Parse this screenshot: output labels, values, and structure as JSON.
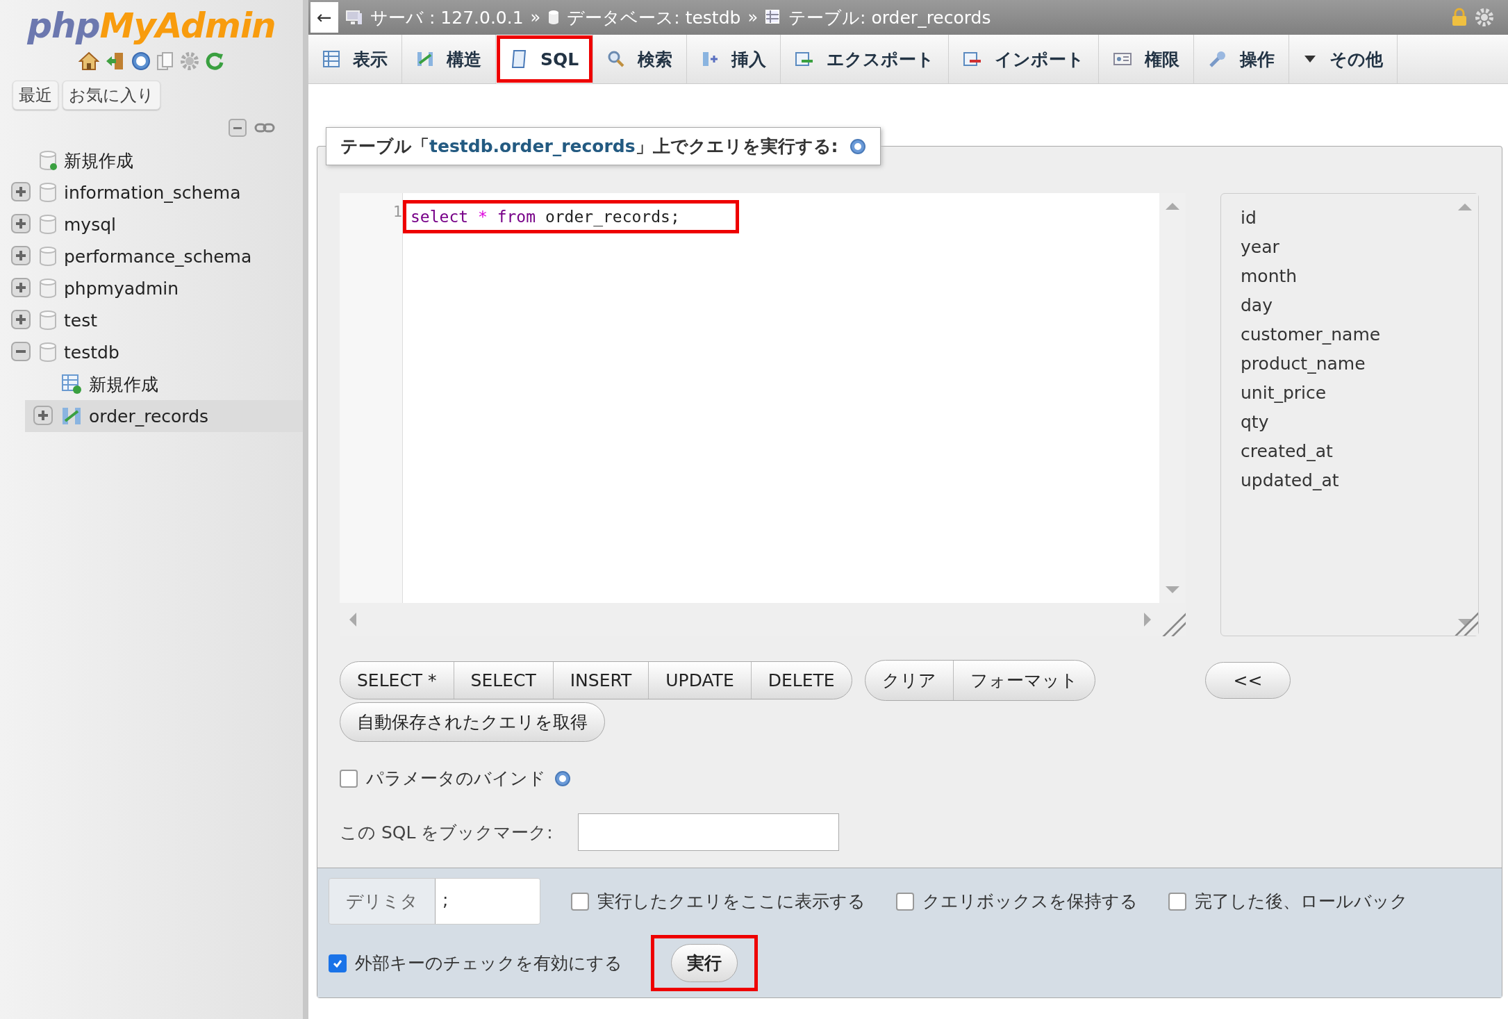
{
  "sidebar": {
    "logo": {
      "left": "php",
      "right": "MyAdmin"
    },
    "quick_tabs": [
      {
        "label": "最近"
      },
      {
        "label": "お気に入り"
      }
    ],
    "tree": [
      {
        "label": "新規作成",
        "kind": "new-db",
        "selected": false
      },
      {
        "label": "information_schema",
        "kind": "db",
        "expanded": false,
        "selected": false
      },
      {
        "label": "mysql",
        "kind": "db",
        "expanded": false,
        "selected": false
      },
      {
        "label": "performance_schema",
        "kind": "db",
        "expanded": false,
        "selected": false
      },
      {
        "label": "phpmyadmin",
        "kind": "db",
        "expanded": false,
        "selected": false
      },
      {
        "label": "test",
        "kind": "db",
        "expanded": false,
        "selected": false
      },
      {
        "label": "testdb",
        "kind": "db",
        "expanded": true,
        "selected": false,
        "children": [
          {
            "label": "新規作成",
            "kind": "new-table",
            "selected": false
          },
          {
            "label": "order_records",
            "kind": "table",
            "expanded": false,
            "selected": true
          }
        ]
      }
    ]
  },
  "breadcrumb": {
    "back": "←",
    "separator": "»",
    "items": [
      {
        "kind": "server",
        "label": "サーバ : 127.0.0.1"
      },
      {
        "kind": "database",
        "label": "データベース: testdb"
      },
      {
        "kind": "table",
        "label": "テーブル: order_records"
      }
    ]
  },
  "tabs": [
    {
      "label": "表示",
      "kind": "browse",
      "selected": false,
      "highlighted": false
    },
    {
      "label": "構造",
      "kind": "structure",
      "selected": false,
      "highlighted": false
    },
    {
      "label": "SQL",
      "kind": "sql",
      "selected": true,
      "highlighted": true
    },
    {
      "label": "検索",
      "kind": "search",
      "selected": false,
      "highlighted": false
    },
    {
      "label": "挿入",
      "kind": "insert",
      "selected": false,
      "highlighted": false
    },
    {
      "label": "エクスポート",
      "kind": "export",
      "selected": false,
      "highlighted": false
    },
    {
      "label": "インポート",
      "kind": "import",
      "selected": false,
      "highlighted": false
    },
    {
      "label": "権限",
      "kind": "privileges",
      "selected": false,
      "highlighted": false
    },
    {
      "label": "操作",
      "kind": "operations",
      "selected": false,
      "highlighted": false
    },
    {
      "label": "その他",
      "kind": "more",
      "selected": false,
      "highlighted": false
    }
  ],
  "query_panel": {
    "legend": {
      "before": "テーブル「",
      "table": "testdb.order_records",
      "after": "」上でクエリを実行する:"
    },
    "editor": {
      "line_number": "1",
      "highlighted": true,
      "tokens": [
        {
          "text": "select",
          "kind": "keyword"
        },
        {
          "text": "*",
          "kind": "operator"
        },
        {
          "text": "from",
          "kind": "keyword"
        },
        {
          "text": "order_records;",
          "kind": "plain"
        }
      ]
    },
    "columns": [
      "id",
      "year",
      "month",
      "day",
      "customer_name",
      "product_name",
      "unit_price",
      "qty",
      "created_at",
      "updated_at"
    ],
    "button_groups": [
      [
        "SELECT *",
        "SELECT",
        "INSERT",
        "UPDATE",
        "DELETE"
      ],
      [
        "クリア",
        "フォーマット"
      ]
    ],
    "insert_button": "<<",
    "autosave_button": "自動保存されたクエリを取得",
    "bind_parameters": {
      "label": "パラメータのバインド",
      "checked": false
    },
    "bookmark": {
      "label": "この SQL をブックマーク:"
    }
  },
  "footer": {
    "delimiter": {
      "label": "デリミタ",
      "value": ";"
    },
    "options": [
      {
        "label": "実行したクエリをここに表示する",
        "checked": false
      },
      {
        "label": "クエリボックスを保持する",
        "checked": false
      },
      {
        "label": "完了した後、ロールバック",
        "checked": false
      }
    ],
    "foreign_keys": {
      "label": "外部キーのチェックを有効にする",
      "checked": true
    },
    "go_button": {
      "label": "実行",
      "highlighted": true
    }
  }
}
